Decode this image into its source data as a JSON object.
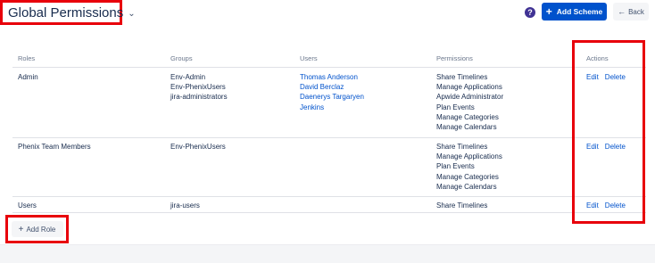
{
  "header": {
    "title": "Global Permissions",
    "chevron": "⌄",
    "help_icon": "?",
    "add_scheme_label": "Add Scheme",
    "add_scheme_icon": "+",
    "back_label": "Back",
    "back_icon": "←"
  },
  "table": {
    "columns": [
      "Roles",
      "Groups",
      "Users",
      "Permissions",
      "Actions"
    ],
    "rows": [
      {
        "role": "Admin",
        "groups": [
          "Env-Admin",
          "Env-PhenixUsers",
          "jira-administrators"
        ],
        "users": [
          "Thomas Anderson",
          "David Berclaz",
          "Daenerys Targaryen",
          "Jenkins"
        ],
        "permissions": [
          "Share Timelines",
          "Manage Applications",
          "Apwide Administrator",
          "Plan Events",
          "Manage Categories",
          "Manage Calendars"
        ],
        "edit": "Edit",
        "delete": "Delete"
      },
      {
        "role": "Phenix Team Members",
        "groups": [
          "Env-PhenixUsers"
        ],
        "users": [],
        "permissions": [
          "Share Timelines",
          "Manage Applications",
          "Plan Events",
          "Manage Categories",
          "Manage Calendars"
        ],
        "edit": "Edit",
        "delete": "Delete"
      },
      {
        "role": "Users",
        "groups": [
          "jira-users"
        ],
        "users": [],
        "permissions": [
          "Share Timelines"
        ],
        "edit": "Edit",
        "delete": "Delete"
      }
    ]
  },
  "footer": {
    "add_role_label": "Add Role",
    "add_role_icon": "+"
  },
  "colors": {
    "highlight": "#e8000b",
    "primary": "#0052cc",
    "help": "#403294",
    "text": "#172b4d",
    "muted": "#6b778c"
  }
}
